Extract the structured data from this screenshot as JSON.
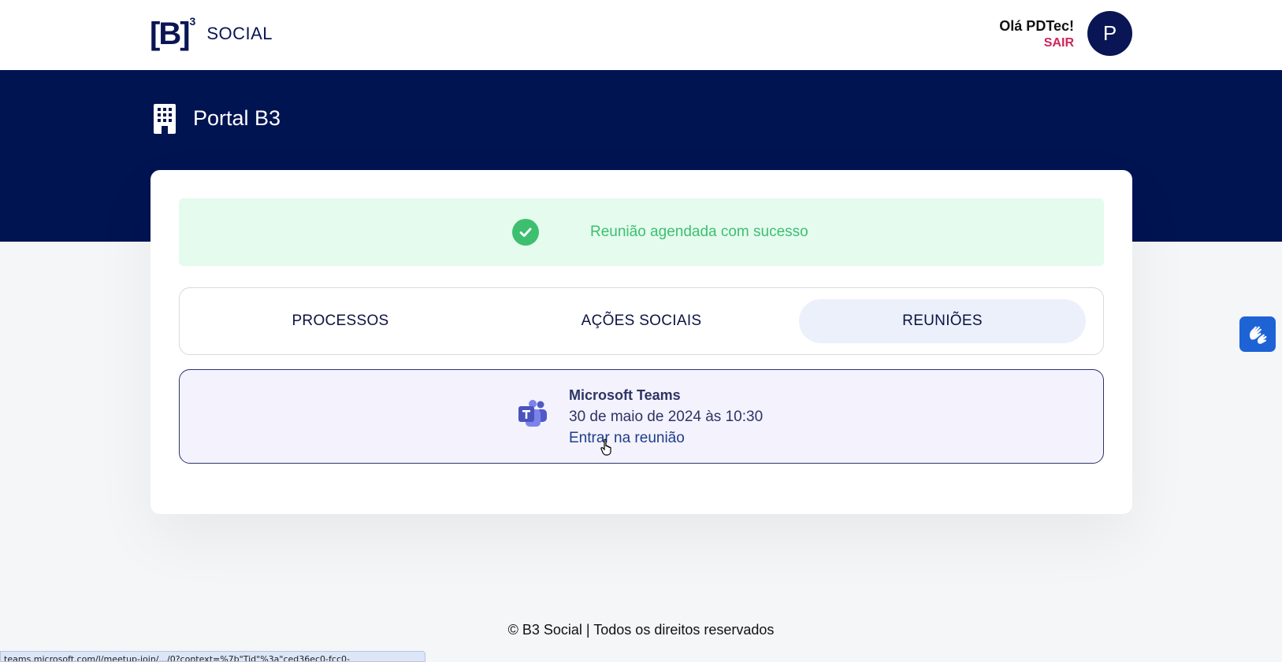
{
  "header": {
    "logo_letter": "[B]",
    "logo_superscript": "3",
    "logo_word": "SOCIAL",
    "greeting": "Olá PDTec!",
    "logout_label": "SAIR",
    "avatar_initial": "P"
  },
  "hero": {
    "title": "Portal B3"
  },
  "alert": {
    "message": "Reunião agendada com sucesso",
    "color": "#3ebf6f"
  },
  "tabs": [
    {
      "label": "PROCESSOS",
      "active": false
    },
    {
      "label": "AÇÕES SOCIAIS",
      "active": false
    },
    {
      "label": "REUNIÕES",
      "active": true
    }
  ],
  "meeting": {
    "platform": "Microsoft Teams",
    "date": "30 de maio de 2024 às 10:30",
    "join_label": "Entrar na reunião",
    "icon": "teams-icon"
  },
  "footer": {
    "text": "© B3 Social | Todos os direitos reservados"
  },
  "status_bar": {
    "url": "teams.microsoft.com/l/meetup-join/.../0?context=%7b\"Tid\"%3a\"ced36ec0-fcc0-"
  },
  "colors": {
    "brand_navy": "#011452",
    "logout": "#d0245a",
    "accessibility": "#1e63d6"
  }
}
